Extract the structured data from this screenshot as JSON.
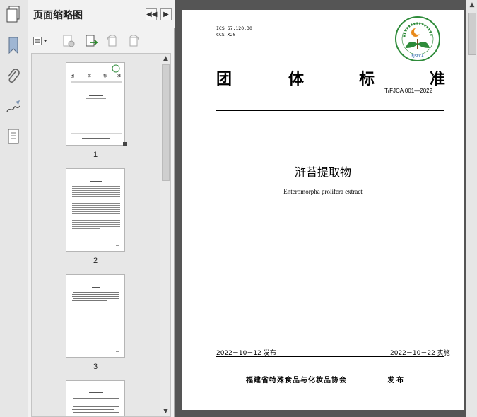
{
  "panel": {
    "title": "页面缩略图",
    "collapse_btn": "◀◀",
    "expand_btn": "▶"
  },
  "thumbnails": [
    {
      "label": "1"
    },
    {
      "label": "2"
    },
    {
      "label": "3"
    }
  ],
  "document": {
    "ics": "ICS   67.120.30",
    "ccs": "CCS  X20",
    "heading_chars": [
      "团",
      "体",
      "标",
      "准"
    ],
    "standard_no": "T/FJCA 001—2022",
    "title": "浒苔提取物",
    "subtitle": "Enteromorpha prolifera extract",
    "publish_date": "2022－10－12 发布",
    "impl_date": "2022－10－22 实施",
    "org": "福建省特殊食品与化妆品协会",
    "issue": "发布",
    "logo_text": "FJSFCA"
  },
  "colors": {
    "logo_green": "#2e8b3a",
    "logo_blue": "#1f5fa8",
    "logo_orange": "#e98a1c",
    "logo_brown": "#7a4a1e"
  }
}
